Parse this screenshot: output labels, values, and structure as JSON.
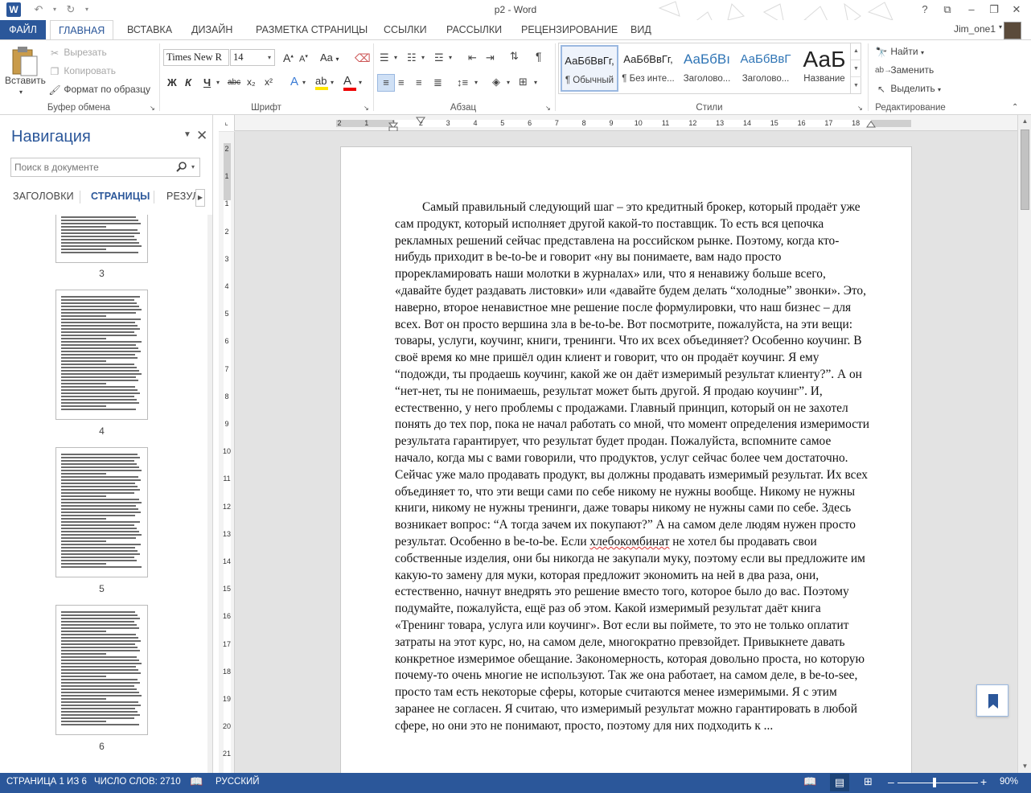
{
  "window": {
    "title": "p2 - Word",
    "help": "?",
    "user_name": "Jim_one1"
  },
  "tabs": [
    {
      "label": "ФАЙЛ"
    },
    {
      "label": "ГЛАВНАЯ"
    },
    {
      "label": "ВСТАВКА"
    },
    {
      "label": "ДИЗАЙН"
    },
    {
      "label": "РАЗМЕТКА СТРАНИЦЫ"
    },
    {
      "label": "ССЫЛКИ"
    },
    {
      "label": "РАССЫЛКИ"
    },
    {
      "label": "РЕЦЕНЗИРОВАНИЕ"
    },
    {
      "label": "ВИД"
    }
  ],
  "clipboard": {
    "paste": "Вставить",
    "cut": "Вырезать",
    "copy": "Копировать",
    "format_painter": "Формат по образцу",
    "group": "Буфер обмена"
  },
  "font": {
    "name": "Times New R",
    "size": "14",
    "bold": "Ж",
    "italic": "К",
    "underline": "Ч",
    "strike": "abc",
    "sub": "x₂",
    "sup": "x²",
    "case": "Aa",
    "grow": "A",
    "shrink": "A",
    "group": "Шрифт"
  },
  "paragraph": {
    "group": "Абзац"
  },
  "styles": {
    "items": [
      {
        "sample": "АаБбВвГг,",
        "name": "¶ Обычный"
      },
      {
        "sample": "АаБбВвГг,",
        "name": "¶ Без инте..."
      },
      {
        "sample": "АаБбВı",
        "name": "Заголово..."
      },
      {
        "sample": "АаБбВвГ",
        "name": "Заголово..."
      },
      {
        "sample": "АаБ",
        "name": "Название"
      }
    ],
    "group": "Стили"
  },
  "editing": {
    "find": "Найти",
    "replace": "Заменить",
    "select": "Выделить",
    "group": "Редактирование"
  },
  "nav": {
    "title": "Навигация",
    "search_placeholder": "Поиск в документе",
    "tabs": [
      "ЗАГОЛОВКИ",
      "СТРАНИЦЫ",
      "РЕЗУЛ"
    ],
    "pages": [
      "3",
      "4",
      "5",
      "6"
    ]
  },
  "ruler": {
    "h": [
      "2",
      "1",
      "1",
      "2",
      "3",
      "4",
      "5",
      "6",
      "7",
      "8",
      "9",
      "10",
      "11",
      "12",
      "13",
      "14",
      "15",
      "16",
      "17",
      "18"
    ],
    "v": [
      "2",
      "1",
      "1",
      "2",
      "3",
      "4",
      "5",
      "6",
      "7",
      "8",
      "9",
      "10",
      "11",
      "12",
      "13",
      "14",
      "15",
      "16",
      "17",
      "18",
      "19",
      "20",
      "21"
    ]
  },
  "document": {
    "para_before": "Самый правильный следующий шаг – это кредитный брокер, который продаёт уже сам продукт, который исполняет другой какой-то поставщик. То есть вся цепочка рекламных решений сейчас представлена на российском рынке. Поэтому, когда кто-нибудь приходит в be-to-be и говорит «ну вы понимаете, вам надо просто прорекламировать наши молотки в журналах» или, что я ненавижу больше всего, «давайте будет раздавать листовки» или «давайте будем делать “холодные” звонки». Это, наверно, второе ненавистное мне решение после формулировки, что наш бизнес – для всех. Вот он просто вершина зла в be-to-be. Вот посмотрите, пожалуйста, на эти вещи: товары, услуги, коучинг, книги, тренинги. Что их всех объединяет? Особенно коучинг. В своё время ко мне пришёл один клиент и говорит, что он продаёт коучинг. Я ему “подожди, ты продаешь коучинг, какой же он даёт измеримый результат клиенту?”. А он “нет-нет, ты не понимаешь, результат может быть другой. Я продаю коучинг”. И, естественно, у него проблемы с продажами. Главный принцип, который он не захотел понять до тех пор, пока не начал работать со мной, что момент определения измеримости результата гарантирует, что результат будет продан. Пожалуйста, вспомните самое начало, когда мы с вами говорили, что продуктов, услуг сейчас более чем достаточно. Сейчас уже мало продавать продукт, вы должны продавать измеримый результат. Их всех объединяет то, что эти вещи сами по себе никому не нужны вообще. Никому не нужны книги, никому не нужны тренинги, даже товары никому не нужны сами по себе. Здесь возникает вопрос: “А тогда зачем их покупают?” А на самом деле людям нужен просто результат. Особенно в be-to-be. Если ",
    "misspelled": "хлебокомбинат",
    "para_after": " не хотел бы продавать свои собственные изделия, они бы никогда не закупали муку, поэтому если вы предложите им какую-то замену для муки, которая предложит экономить на ней в два раза, они, естественно, начнут внедрять это решение вместо того, которое было до вас. Поэтому подумайте, пожалуйста, ещё раз об этом. Какой измеримый результат даёт книга «Тренинг товара, услуга или коучинг». Вот если вы поймете, то это не только оплатит затраты на этот курс, но, на самом деле, многократно превзойдет. Привыкнете давать конкретное измеримое обещание. Закономерность, которая довольно проста, но которую почему-то очень многие не используют.  Так же она работает, на самом деле, в be-to-see, просто там есть некоторые сферы, которые считаются менее измеримыми. Я с этим заранее не согласен. Я считаю, что измеримый результат можно гарантировать в любой сфере, но они это не понимают, просто, поэтому для них подходить к ..."
  },
  "status": {
    "page": "СТРАНИЦА 1 ИЗ 6",
    "words": "ЧИСЛО СЛОВ: 2710",
    "language": "РУССКИЙ",
    "zoom": "90%"
  },
  "colors": {
    "accent": "#2b579a",
    "status_bg": "#2b579a"
  }
}
